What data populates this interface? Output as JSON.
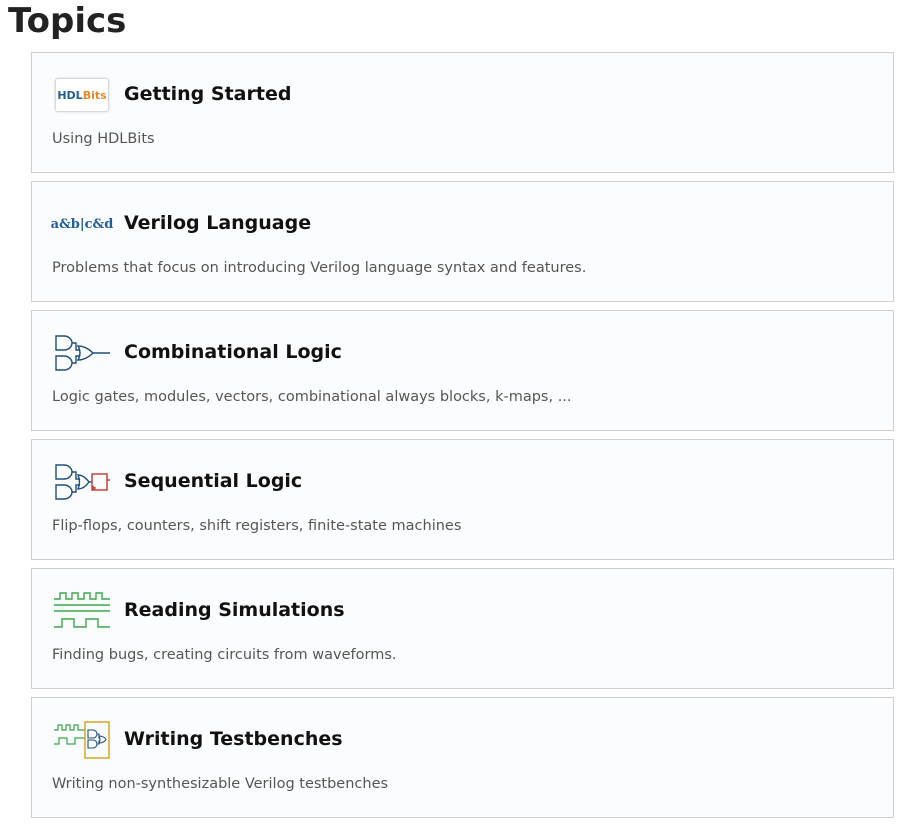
{
  "page": {
    "title": "Topics"
  },
  "topics": [
    {
      "title": "Getting Started",
      "description": "Using HDLBits",
      "icon": "hdlbits-logo-icon",
      "logo_text_a": "HDL",
      "logo_text_b": "Bits"
    },
    {
      "title": "Verilog Language",
      "description": "Problems that focus on introducing Verilog language syntax and features.",
      "icon": "verilog-expression-icon",
      "icon_text": "a&b|c&d"
    },
    {
      "title": "Combinational Logic",
      "description": "Logic gates, modules, vectors, combinational always blocks, k-maps, ...",
      "icon": "logic-gates-icon"
    },
    {
      "title": "Sequential Logic",
      "description": "Flip-flops, counters, shift registers, finite-state machines",
      "icon": "flip-flop-circuit-icon"
    },
    {
      "title": "Reading Simulations",
      "description": "Finding bugs, creating circuits from waveforms.",
      "icon": "waveform-icon"
    },
    {
      "title": "Writing Testbenches",
      "description": "Writing non-synthesizable Verilog testbenches",
      "icon": "testbench-icon"
    }
  ],
  "colors": {
    "logic_blue": "#1f4e79",
    "flipflop_red": "#c0392b",
    "wave_green": "#3aa64a",
    "testbench_gold": "#d4a017",
    "card_border": "#cfcfcf"
  }
}
